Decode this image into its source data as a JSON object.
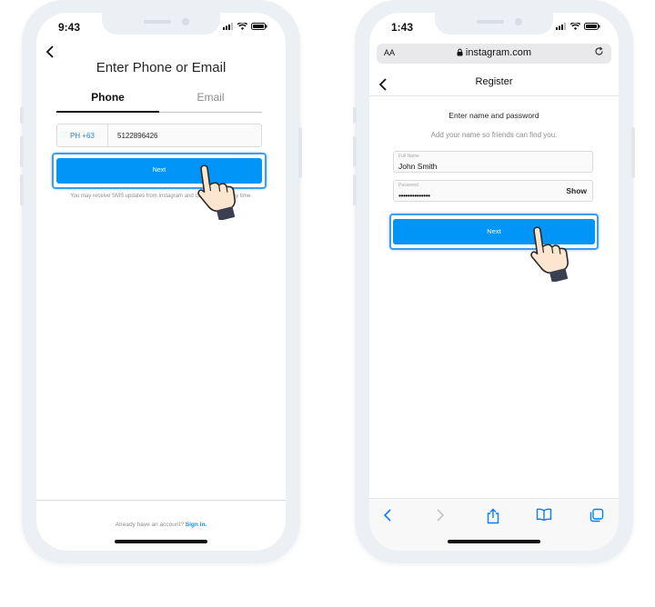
{
  "left_phone": {
    "status_time": "9:43",
    "title": "Enter Phone or Email",
    "tabs": [
      {
        "label": "Phone",
        "active": true
      },
      {
        "label": "Email",
        "active": false
      }
    ],
    "country_code": "PH +63",
    "phone_number": "5122896426",
    "next_label": "Next",
    "sms_note": "You may receive SMS updates from Instagram and can opt out at any time.",
    "footer_text": "Already have an account?",
    "footer_link": "Sign in."
  },
  "right_phone": {
    "status_time": "1:43",
    "url_aa": "AA",
    "url": "instagram.com",
    "header_title": "Register",
    "heading": "Enter name and password",
    "subheading": "Add your name so friends can find you.",
    "full_name_label": "Full Name",
    "full_name_value": "John Smith",
    "password_label": "Password",
    "password_value": "••••••••••••••",
    "show_label": "Show",
    "next_label": "Next"
  },
  "colors": {
    "primary_blue": "#0095f6",
    "highlight_outline": "#3b9cf0",
    "safari_blue": "#0a7cff",
    "phone_frame": "#eceff4"
  },
  "icons": {
    "back": "chevron-left-icon",
    "signal": "signal-icon",
    "wifi": "wifi-icon",
    "battery": "battery-icon",
    "lock": "lock-icon",
    "reload": "reload-icon",
    "tap_hand": "pointing-hand-icon",
    "safari_back": "chevron-left-icon",
    "safari_forward": "chevron-right-icon",
    "share": "share-icon",
    "bookmarks": "book-icon",
    "tabs": "tabs-icon"
  }
}
